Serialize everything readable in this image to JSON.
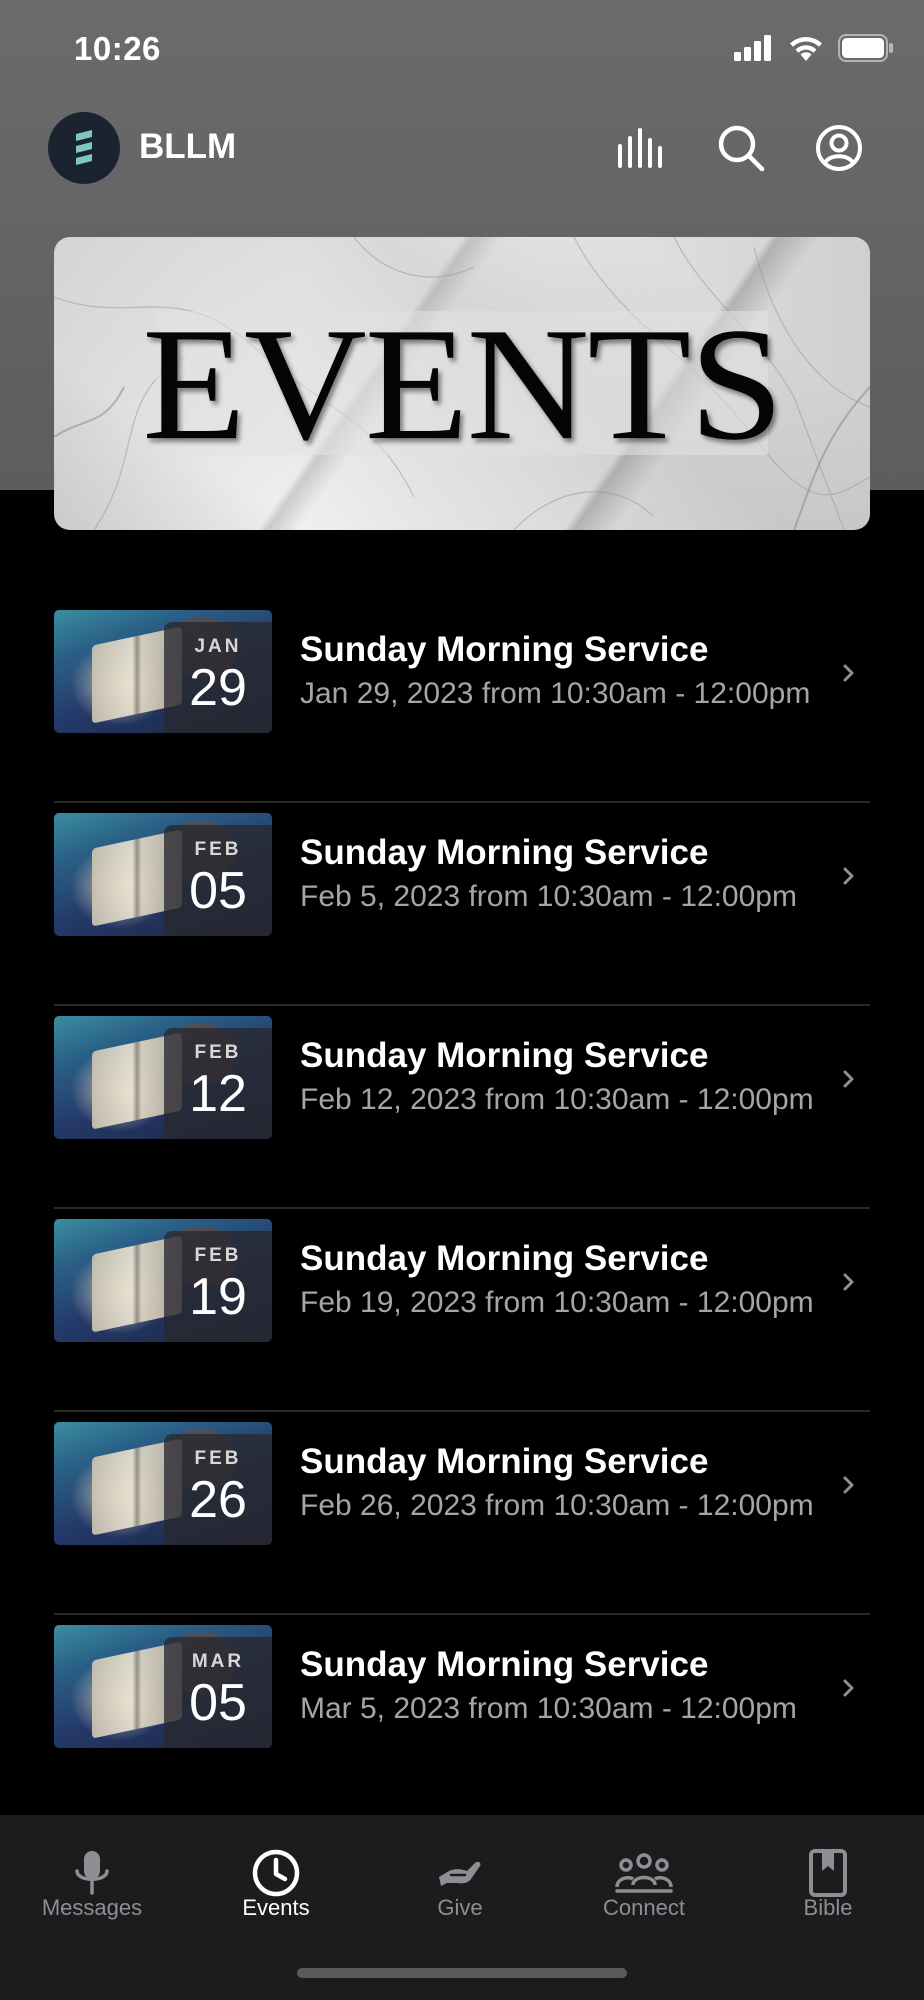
{
  "status_bar": {
    "time": "10:26"
  },
  "header": {
    "app_name": "BLLM",
    "icons": [
      "audio-bars-icon",
      "search-icon",
      "account-icon"
    ]
  },
  "banner": {
    "title": "EVENTS"
  },
  "events": [
    {
      "month": "JAN",
      "day": "29",
      "title": "Sunday Morning Service",
      "subtitle": "Jan 29, 2023 from 10:30am - 12:00pm"
    },
    {
      "month": "FEB",
      "day": "05",
      "title": "Sunday Morning Service",
      "subtitle": "Feb 5, 2023 from 10:30am - 12:00pm"
    },
    {
      "month": "FEB",
      "day": "12",
      "title": "Sunday Morning Service",
      "subtitle": "Feb 12, 2023 from 10:30am - 12:00pm"
    },
    {
      "month": "FEB",
      "day": "19",
      "title": "Sunday Morning Service",
      "subtitle": "Feb 19, 2023 from 10:30am - 12:00pm"
    },
    {
      "month": "FEB",
      "day": "26",
      "title": "Sunday Morning Service",
      "subtitle": "Feb 26, 2023 from 10:30am - 12:00pm"
    },
    {
      "month": "MAR",
      "day": "05",
      "title": "Sunday Morning Service",
      "subtitle": "Mar 5, 2023 from 10:30am - 12:00pm"
    }
  ],
  "tabs": [
    {
      "label": "Messages",
      "icon": "microphone-icon",
      "active": false
    },
    {
      "label": "Events",
      "icon": "clock-icon",
      "active": true
    },
    {
      "label": "Give",
      "icon": "giving-hand-icon",
      "active": false
    },
    {
      "label": "Connect",
      "icon": "people-group-icon",
      "active": false
    },
    {
      "label": "Bible",
      "icon": "book-icon",
      "active": false
    }
  ],
  "colors": {
    "background": "#000000",
    "header_bg": "#616161",
    "tab_bar_bg": "#1c1c1e",
    "tab_inactive": "#8e8e93",
    "tab_active": "#ffffff",
    "subtitle_gray": "#a5a5a5",
    "logo_accent": "#7ec8c0"
  }
}
